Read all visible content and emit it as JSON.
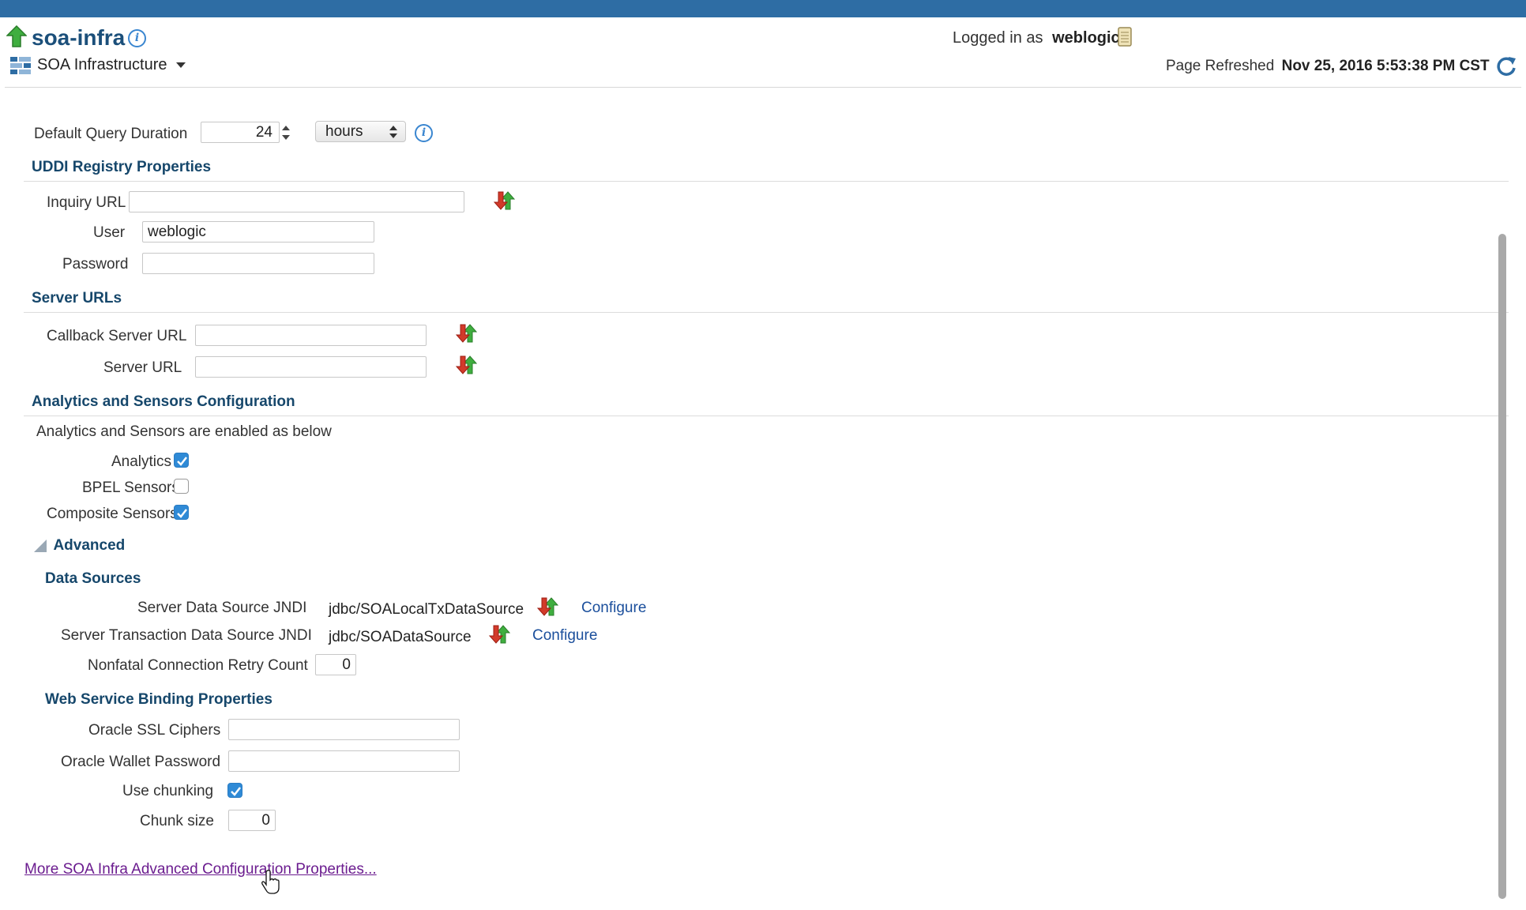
{
  "header": {
    "app_title": "soa-infra",
    "menu_label": "SOA Infrastructure",
    "logged_in_prefix": "Logged in as",
    "logged_in_user": "weblogic",
    "refreshed_prefix": "Page Refreshed",
    "refreshed_time": "Nov 25, 2016 5:53:38 PM CST"
  },
  "query": {
    "label": "Default Query Duration",
    "value": "24",
    "unit": "hours"
  },
  "uddi": {
    "title": "UDDI Registry Properties",
    "inquiry_label": "Inquiry URL",
    "inquiry_value": "",
    "user_label": "User",
    "user_value": "weblogic",
    "password_label": "Password",
    "password_value": ""
  },
  "server_urls": {
    "title": "Server URLs",
    "callback_label": "Callback Server URL",
    "callback_value": "",
    "server_label": "Server URL",
    "server_value": ""
  },
  "analytics": {
    "title": "Analytics and Sensors Configuration",
    "desc": "Analytics and Sensors are enabled as below",
    "items": [
      {
        "label": "Analytics",
        "checked": true
      },
      {
        "label": "BPEL Sensors",
        "checked": false
      },
      {
        "label": "Composite Sensors",
        "checked": true
      }
    ]
  },
  "advanced": {
    "title": "Advanced",
    "data_sources": {
      "title": "Data Sources",
      "server_ds_label": "Server Data Source JNDI",
      "server_ds_value": "jdbc/SOALocalTxDataSource",
      "tx_ds_label": "Server Transaction Data Source JNDI",
      "tx_ds_value": "jdbc/SOADataSource",
      "configure_label": "Configure",
      "retry_label": "Nonfatal Connection Retry Count",
      "retry_value": "0"
    },
    "ws": {
      "title": "Web Service Binding Properties",
      "ssl_label": "Oracle SSL Ciphers",
      "ssl_value": "",
      "wallet_label": "Oracle Wallet Password",
      "wallet_value": "",
      "chunking_label": "Use chunking",
      "chunking_checked": true,
      "chunk_size_label": "Chunk size",
      "chunk_size_value": "0"
    }
  },
  "footer_link": "More SOA Infra Advanced Configuration Properties..."
}
